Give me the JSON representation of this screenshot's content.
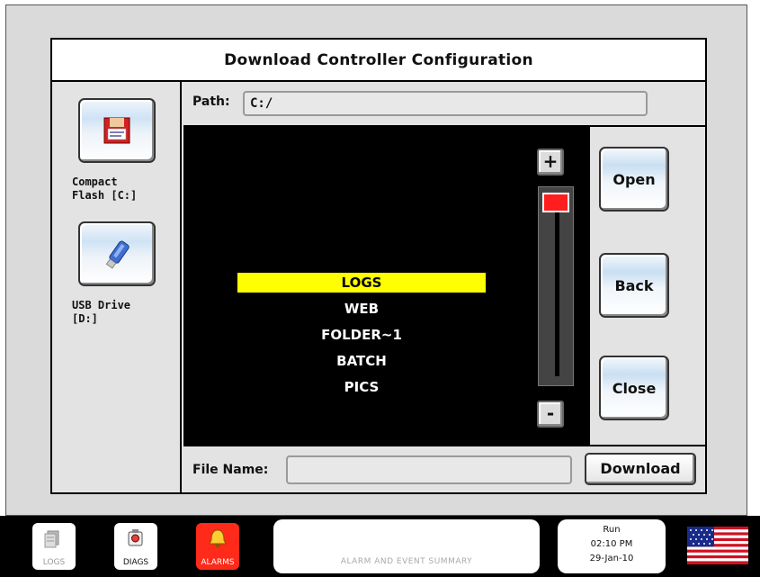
{
  "dialog": {
    "title": "Download Controller Configuration"
  },
  "drives": [
    {
      "label": "Compact Flash [C:]",
      "icon": "compact-flash-icon"
    },
    {
      "label": "USB Drive [D:]",
      "icon": "usb-drive-icon"
    }
  ],
  "path": {
    "label": "Path:",
    "value": "C:/"
  },
  "files": {
    "items": [
      "LOGS",
      "WEB",
      "FOLDER~1",
      "BATCH",
      "PICS"
    ],
    "selected": "LOGS"
  },
  "scroll": {
    "up_label": "+",
    "down_label": "-"
  },
  "actions": {
    "open": "Open",
    "back": "Back",
    "close": "Close"
  },
  "file_name": {
    "label": "File Name:",
    "value": "",
    "download_label": "Download"
  },
  "taskbar": {
    "logs": "LOGS",
    "diags": "DIAGS",
    "alarms": "ALARMS",
    "summary": "ALARM AND EVENT SUMMARY",
    "status": {
      "state": "Run",
      "time": "02:10 PM",
      "date": "29-Jan-10"
    }
  },
  "colors": {
    "selected_bg": "#ffff00",
    "alarms_bg": "#ff2a1a",
    "list_bg": "#000000",
    "thumb": "#ff1e1e"
  }
}
